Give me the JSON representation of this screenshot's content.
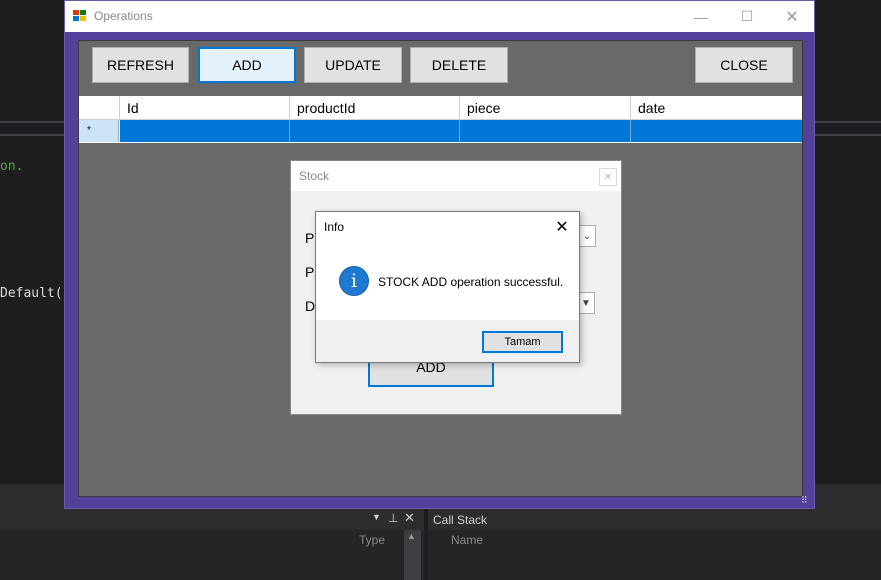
{
  "ide": {
    "code_line_1": "on.",
    "code_line_2": "Default(",
    "panel_right_title": "Call Stack",
    "panel_left_col_type": "Type",
    "panel_right_col_name": "Name"
  },
  "operations_window": {
    "title": "Operations",
    "minimize_icon": "minimize-icon",
    "maximize_icon": "maximize-icon",
    "close_icon": "close-icon",
    "toolbar": {
      "refresh": "REFRESH",
      "add": "ADD",
      "update": "UPDATE",
      "delete": "DELETE",
      "close": "CLOSE"
    },
    "grid": {
      "columns": [
        "Id",
        "productId",
        "piece",
        "date"
      ],
      "new_row_marker": "*"
    }
  },
  "stock_dialog": {
    "title": "Stock",
    "labels": [
      "P",
      "P",
      "D"
    ],
    "add_button": "ADD"
  },
  "info_dialog": {
    "title": "Info",
    "message": "STOCK ADD operation successful.",
    "icon": "info-icon",
    "ok_button": "Tamam"
  },
  "colors": {
    "accent": "#0078d7",
    "window_border": "#52409a",
    "ide_background": "#1e1e1e"
  }
}
